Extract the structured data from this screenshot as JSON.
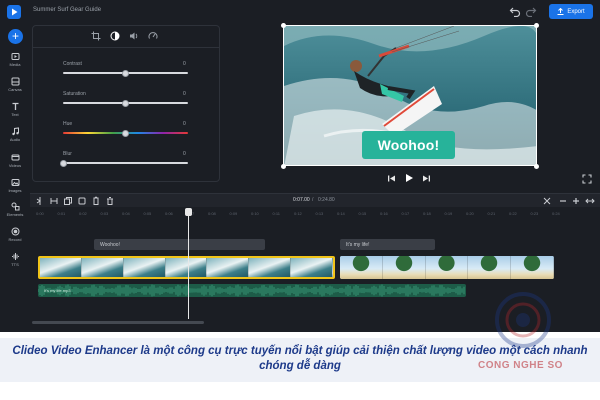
{
  "app": {
    "project_title": "Summer Surf Gear Guide",
    "export_label": "Export"
  },
  "rail": {
    "items": [
      {
        "label": "Media",
        "icon": "media-icon"
      },
      {
        "label": "Canvas",
        "icon": "canvas-icon"
      },
      {
        "label": "Text",
        "icon": "text-icon"
      },
      {
        "label": "Audio",
        "icon": "audio-icon"
      },
      {
        "label": "Videos",
        "icon": "videos-icon"
      },
      {
        "label": "Images",
        "icon": "images-icon"
      },
      {
        "label": "Elements",
        "icon": "elements-icon"
      },
      {
        "label": "Record",
        "icon": "record-icon"
      },
      {
        "label": "TTS",
        "icon": "tts-icon"
      }
    ]
  },
  "adjust": {
    "tabs": [
      "crop-icon",
      "adjust-icon",
      "volume-icon",
      "speed-icon"
    ],
    "sliders": [
      {
        "label": "Contrast",
        "value": "0",
        "level": 0.5,
        "style": "plain"
      },
      {
        "label": "Saturation",
        "value": "0",
        "level": 0.5,
        "style": "plain"
      },
      {
        "label": "Hue",
        "value": "0",
        "level": 0.5,
        "style": "rainbow"
      },
      {
        "label": "Blur",
        "value": "0",
        "level": 0.0,
        "style": "plain"
      }
    ]
  },
  "preview": {
    "caption": "Woohoo!"
  },
  "timeline": {
    "time_current": "0:07.00",
    "time_separator": "/",
    "time_total": "0:24.80",
    "ruler_ticks": [
      "0:00",
      "0:01",
      "0:02",
      "0:03",
      "0:04",
      "0:05",
      "0:06",
      "0:07",
      "0:08",
      "0:09",
      "0:10",
      "0:11",
      "0:12",
      "0:13",
      "0:14",
      "0:15",
      "0:16",
      "0:17",
      "0:18",
      "0:19",
      "0:20",
      "0:21",
      "0:22",
      "0:23",
      "0:24"
    ],
    "text_clips": [
      "Woohoo!",
      "It's my life!"
    ],
    "audio_label": "It's my life.mp3"
  },
  "colors": {
    "accent": "#1a73e8",
    "caption_bg": "#27b39a",
    "clip_border": "#f0c419",
    "audio_bg": "#1d5c48"
  },
  "banner": {
    "text": "Clideo Video Enhancer là một công cụ trực tuyến nổi bật giúp cải thiện chất lượng video một cách nhanh chóng dễ dàng",
    "watermark": "CONG NGHE SO"
  }
}
